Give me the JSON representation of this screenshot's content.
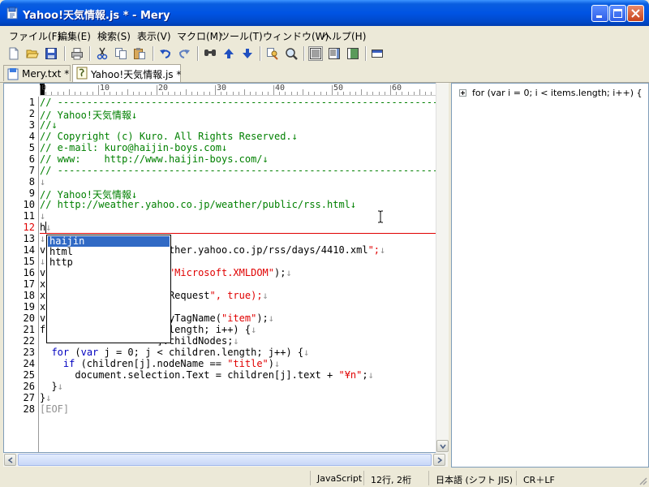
{
  "window": {
    "title": "Yahoo!天気情報.js * - Mery"
  },
  "menu": [
    "ファイル(F)",
    "編集(E)",
    "検索(S)",
    "表示(V)",
    "マクロ(M)",
    "ツール(T)",
    "ウィンドウ(W)",
    "ヘルプ(H)"
  ],
  "tabs": [
    {
      "label": "Mery.txt *",
      "active": false
    },
    {
      "label": "Yahoo!天気情報.js *",
      "active": true
    }
  ],
  "ruler": {
    "marks": [
      "0",
      "10",
      "20",
      "30",
      "40",
      "50",
      "60"
    ]
  },
  "editor": {
    "current_line": 12,
    "eof_label": "[EOF]",
    "lines": [
      "// -----------------------------------------------------------------",
      "// Yahoo!天気情報↓",
      "//↓",
      "// Copyright (c) Kuro. All Rights Reserved.↓",
      "// e-mail: kuro@haijin-boys.com↓",
      "// www:    http://www.haijin-boys.com/↓",
      "// -----------------------------------------------------------------",
      "↓",
      "// Yahoo!天気情報↓",
      "// http://weather.yahoo.co.jp/weather/public/rss.html↓",
      "↓",
      "h↓",
      "↓",
      "v                   eather.yahoo.co.jp/rss/days/4410.xml\";↓",
      "↓",
      "v                   t(\"Microsoft.XMLDOM\");↓",
      "x",
      "x                   TPRequest\", true);↓",
      "x",
      "v                   sByTagName(\"item\");↓",
      "f                   s.length; i++) {↓",
      "                    ].childNodes;↓",
      "  for (var j = 0; j < children.length; j++) {↓",
      "    if (children[j].nodeName == \"title\")↓",
      "      document.selection.Text = children[j].text + \"¥n\";↓",
      "  }↓",
      "}↓",
      "[EOF]"
    ]
  },
  "autocomplete": {
    "items": [
      "haijin",
      "html",
      "http"
    ],
    "selected_index": 0
  },
  "outline": {
    "items": [
      "for (var i = 0; i < items.length; i++) {"
    ]
  },
  "status": {
    "language": "JavaScript",
    "position": "12行, 2桁",
    "encoding": "日本語 (シフト JIS)",
    "line_ending": "CR＋LF"
  },
  "colors": {
    "comment": "#008000",
    "string": "#E00000",
    "keyword": "#0000C0",
    "title_bar": "#0054E3"
  },
  "icons": [
    "app-icon",
    "new-file-icon",
    "open-folder-icon",
    "save-icon",
    "print-icon",
    "cut-icon",
    "copy-icon",
    "paste-icon",
    "undo-icon",
    "redo-icon",
    "find-icon",
    "find-previous-icon",
    "find-next-icon",
    "replace-icon",
    "search-files-icon",
    "word-wrap-icon",
    "wrap-window-icon",
    "wrap-column-icon",
    "show-ruler-icon"
  ]
}
